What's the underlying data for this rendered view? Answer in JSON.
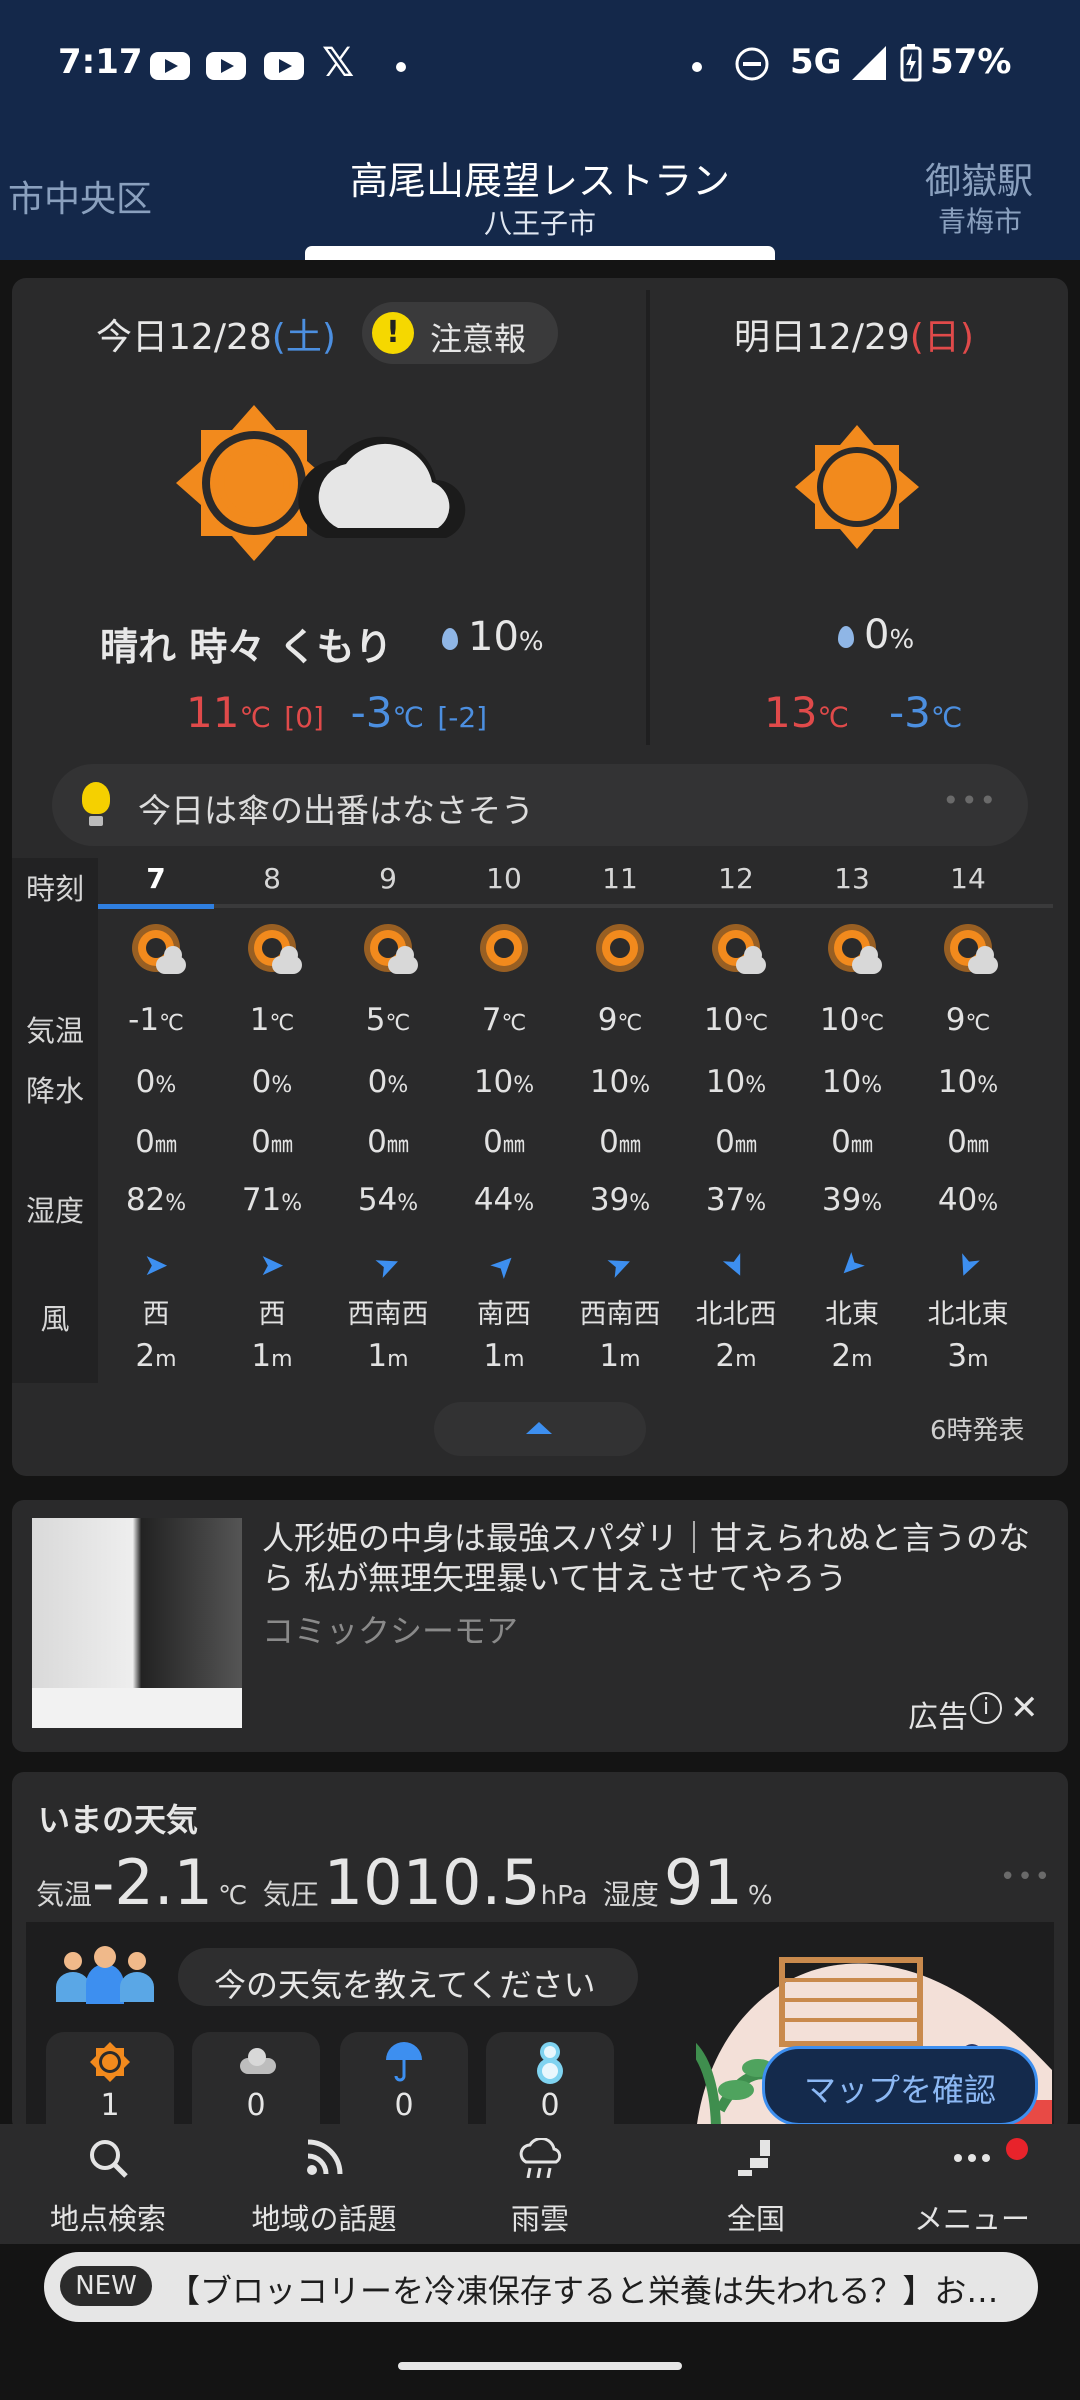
{
  "status_bar": {
    "time": "7:17",
    "network": "5G",
    "battery": "57%",
    "app_icons": [
      "youtube-icon",
      "youtube-icon",
      "youtube-icon",
      "x-icon"
    ]
  },
  "header": {
    "left_location": "市中央区",
    "center_title": "高尾山展望レストラン",
    "center_subtitle": "八王子市",
    "right_title": "御嶽駅",
    "right_subtitle": "青梅市"
  },
  "today": {
    "label": "今日",
    "date": "12/28",
    "weekday_open": "(",
    "weekday": "土",
    "weekday_close": ")",
    "alert": "注意報",
    "alert_icon": "!",
    "condition": "晴れ 時々 くもり",
    "precip": "10",
    "precip_unit": "%",
    "high": "11",
    "high_unit": "℃",
    "high_diff": "[0]",
    "low": "-3",
    "low_unit": "℃",
    "low_diff": "[-2]"
  },
  "tomorrow": {
    "label": "明日",
    "date": "12/29",
    "weekday_open": "(",
    "weekday": "日",
    "weekday_close": ")",
    "precip": "0",
    "precip_unit": "%",
    "high": "13",
    "high_unit": "℃",
    "low": "-3",
    "low_unit": "℃"
  },
  "tip": {
    "text": "今日は傘の出番はなさそう",
    "more": "•••"
  },
  "hourly": {
    "labels": {
      "time": "時刻",
      "temp": "気温",
      "precip": "降水",
      "humidity": "湿度",
      "wind": "風"
    },
    "hours": [
      {
        "hour": "7",
        "icon": "sun-cloud",
        "temp": "-1",
        "temp_unit": "℃",
        "pop": "0",
        "pop_unit": "%",
        "mm": "0",
        "mm_unit": "㎜",
        "hum": "82",
        "hum_unit": "%",
        "arrow": "➤",
        "wind_dir": "西",
        "wind_speed": "2",
        "speed_unit": "m"
      },
      {
        "hour": "8",
        "icon": "sun-cloud",
        "temp": "1",
        "temp_unit": "℃",
        "pop": "0",
        "pop_unit": "%",
        "mm": "0",
        "mm_unit": "㎜",
        "hum": "71",
        "hum_unit": "%",
        "arrow": "➤",
        "wind_dir": "西",
        "wind_speed": "1",
        "speed_unit": "m"
      },
      {
        "hour": "9",
        "icon": "sun-cloud",
        "temp": "5",
        "temp_unit": "℃",
        "pop": "0",
        "pop_unit": "%",
        "mm": "0",
        "mm_unit": "㎜",
        "hum": "54",
        "hum_unit": "%",
        "arrow": "➤",
        "wind_dir": "西南西",
        "wind_speed": "1",
        "speed_unit": "m"
      },
      {
        "hour": "10",
        "icon": "sun",
        "temp": "7",
        "temp_unit": "℃",
        "pop": "10",
        "pop_unit": "%",
        "mm": "0",
        "mm_unit": "㎜",
        "hum": "44",
        "hum_unit": "%",
        "arrow": "➤",
        "wind_dir": "南西",
        "wind_speed": "1",
        "speed_unit": "m"
      },
      {
        "hour": "11",
        "icon": "sun",
        "temp": "9",
        "temp_unit": "℃",
        "pop": "10",
        "pop_unit": "%",
        "mm": "0",
        "mm_unit": "㎜",
        "hum": "39",
        "hum_unit": "%",
        "arrow": "➤",
        "wind_dir": "西南西",
        "wind_speed": "1",
        "speed_unit": "m"
      },
      {
        "hour": "12",
        "icon": "sun-cloud",
        "temp": "10",
        "temp_unit": "℃",
        "pop": "10",
        "pop_unit": "%",
        "mm": "0",
        "mm_unit": "㎜",
        "hum": "37",
        "hum_unit": "%",
        "arrow": "➤",
        "wind_dir": "北北西",
        "wind_speed": "2",
        "speed_unit": "m"
      },
      {
        "hour": "13",
        "icon": "sun-cloud",
        "temp": "10",
        "temp_unit": "℃",
        "pop": "10",
        "pop_unit": "%",
        "mm": "0",
        "mm_unit": "㎜",
        "hum": "39",
        "hum_unit": "%",
        "arrow": "➤",
        "wind_dir": "北東",
        "wind_speed": "2",
        "speed_unit": "m"
      },
      {
        "hour": "14",
        "icon": "sun-cloud",
        "temp": "9",
        "temp_unit": "℃",
        "pop": "10",
        "pop_unit": "%",
        "mm": "0",
        "mm_unit": "㎜",
        "hum": "40",
        "hum_unit": "%",
        "arrow": "➤",
        "wind_dir": "北北東",
        "wind_speed": "3",
        "speed_unit": "m"
      }
    ],
    "published": "6時発表"
  },
  "ad": {
    "title": "人形姫の中身は最強スパダリ｜甘えられぬと言うのなら 私が無理矢理暴いて甘えさせてやろう",
    "source": "コミックシーモア",
    "label": "広告",
    "info_icon": "i",
    "close_icon": "✕"
  },
  "current": {
    "title": "いまの天気",
    "temp_label": "気温",
    "temp_value": "-2.1",
    "temp_unit": "℃",
    "pressure_label": "気圧",
    "pressure_value": "1010.5",
    "pressure_unit": "hPa",
    "humidity_label": "湿度",
    "humidity_value": "91",
    "humidity_unit": "%",
    "more": "•••",
    "ask": "今の天気を教えてください",
    "votes": [
      {
        "icon": "sun-icon",
        "count": "1"
      },
      {
        "icon": "cloud-icon",
        "count": "0"
      },
      {
        "icon": "umbrella-icon",
        "count": "0"
      },
      {
        "icon": "snowman-icon",
        "count": "0"
      }
    ],
    "map_button": "マップを確認"
  },
  "bottom_nav": {
    "items": [
      {
        "label": "地点検索",
        "icon": "search-icon"
      },
      {
        "label": "地域の話題",
        "icon": "rss-icon"
      },
      {
        "label": "雨雲",
        "icon": "rain-cloud-icon"
      },
      {
        "label": "全国",
        "icon": "japan-map-icon"
      },
      {
        "label": "メニュー",
        "icon": "more-icon"
      }
    ]
  },
  "news": {
    "badge": "NEW",
    "text": "【ブロッコリーを冷凍保存すると栄養は失われる？】お…"
  },
  "colors": {
    "header_bg": "#14284a",
    "card_bg": "#2a2a2b",
    "accent_blue": "#3d8ff0",
    "high_red": "#e04a4a",
    "low_blue": "#4c8fe0",
    "sun_orange": "#f28a1d"
  }
}
